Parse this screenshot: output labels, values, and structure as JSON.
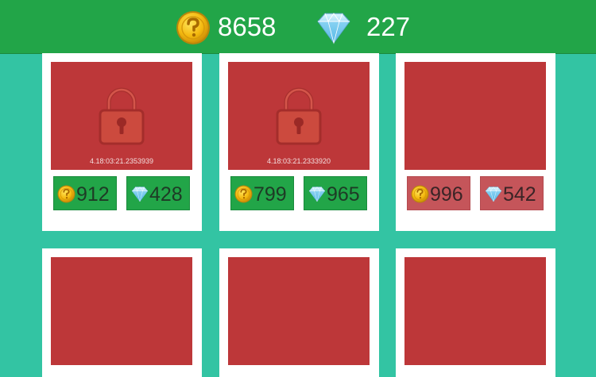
{
  "header": {
    "coin_icon": "gold-coin-icon",
    "coins": "8658",
    "gem_icon": "diamond-icon",
    "gems": "227"
  },
  "colors": {
    "header_bg": "#22a548",
    "page_bg": "#33c4a3",
    "card_art": "#bd3739",
    "buy_button": "#22a548",
    "buy_button_disabled": "#c5555a"
  },
  "cards": [
    {
      "locked": true,
      "timer": "4.18:03:21.2353939",
      "coin_price": "912",
      "gem_price": "428",
      "affordable": true
    },
    {
      "locked": true,
      "timer": "4.18:03:21.2333920",
      "coin_price": "799",
      "gem_price": "965",
      "affordable": true
    },
    {
      "locked": false,
      "timer": "",
      "coin_price": "996",
      "gem_price": "542",
      "affordable": false
    },
    {
      "locked": false
    },
    {
      "locked": false
    },
    {
      "locked": false
    }
  ]
}
